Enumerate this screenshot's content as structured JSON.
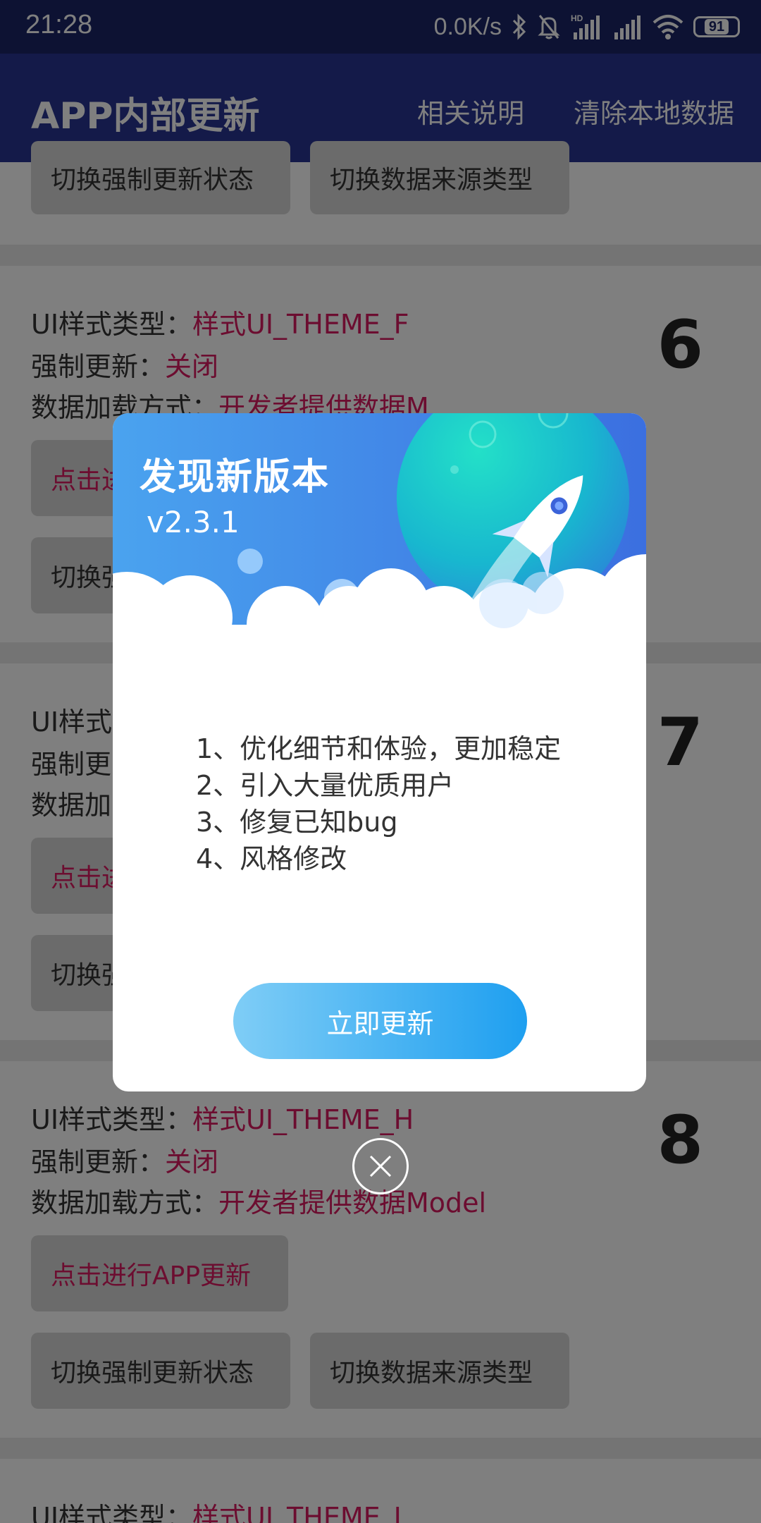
{
  "status_bar": {
    "time": "21:28",
    "net_speed": "0.0K/s",
    "battery": "91",
    "icons": [
      "bluetooth-icon",
      "bell-muted-icon",
      "hd-signal-icon",
      "signal-icon",
      "wifi-icon",
      "battery-icon"
    ]
  },
  "app_bar": {
    "title": "APP内部更新",
    "actions": [
      "相关说明",
      "清除本地数据"
    ]
  },
  "list": {
    "top_buttons": [
      "切换强制更新状态",
      "切换数据来源类型"
    ],
    "cards": [
      {
        "number": "6",
        "ui_style_label": "UI样式类型：",
        "ui_style_value": "样式UI_THEME_F",
        "force_label": "强制更新：",
        "force_value": "关闭",
        "data_label": "数据加载方式：",
        "data_value": "开发者提供数据M",
        "update_btn": "点击进",
        "toggle_btn": "切换强"
      },
      {
        "number": "7",
        "ui_style_label": "UI样式",
        "force_label": "强制更",
        "data_label": "数据加",
        "update_btn": "点击进",
        "toggle_btn": "切换强"
      },
      {
        "number": "8",
        "ui_style_label": "UI样式类型：",
        "ui_style_value": "样式UI_THEME_H",
        "force_label": "强制更新：",
        "force_value": "关闭",
        "data_label": "数据加载方式：",
        "data_value": "开发者提供数据Model",
        "update_btn": "点击进行APP更新",
        "toggle_force_btn": "切换强制更新状态",
        "toggle_source_btn": "切换数据来源类型"
      },
      {
        "ui_style_label": "UI样式类型：",
        "ui_style_value": "样式UI_THEME_I"
      }
    ]
  },
  "dialog": {
    "title": "发现新版本",
    "version": "v2.3.1",
    "content": [
      "1、优化细节和体验，更加稳定",
      "2、引入大量优质用户",
      "3、修复已知bug",
      "4、风格修改"
    ],
    "update_button": "立即更新"
  },
  "colors": {
    "status_bar": "#1b2566",
    "app_bar": "#283593",
    "accent_value": "#d81b60",
    "dialog_header_start": "#4aa3ef",
    "dialog_header_end": "#3b6fe0",
    "update_button_start": "#7fcdf6",
    "update_button_end": "#1e9ff0"
  }
}
